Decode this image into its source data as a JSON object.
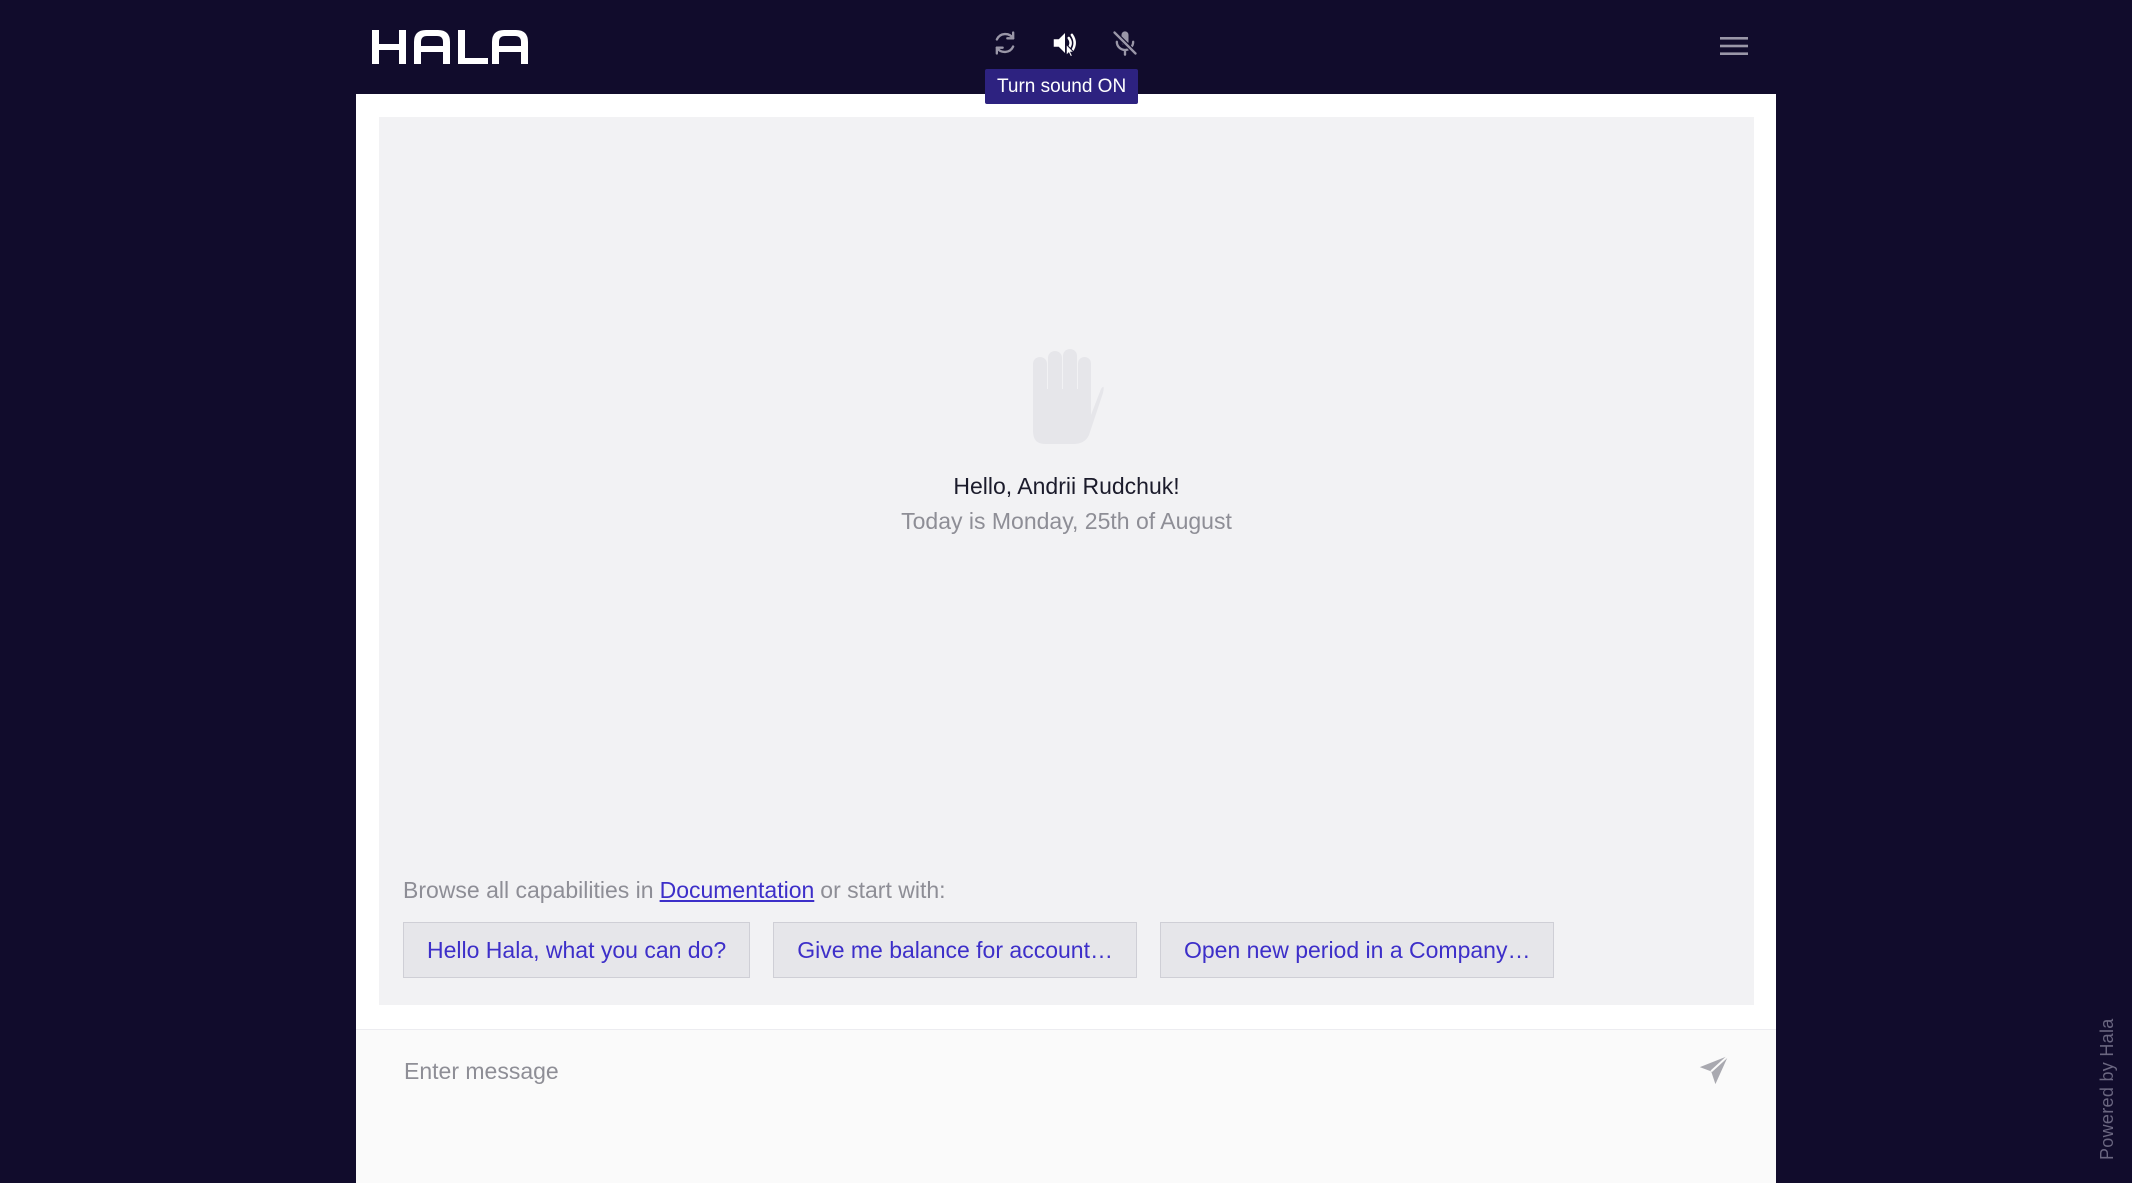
{
  "header": {
    "logo_text": "HALA",
    "icons": [
      "refresh-icon",
      "sound-off-icon",
      "mic-off-icon",
      "hamburger-menu-icon"
    ],
    "tooltip": "Turn sound ON"
  },
  "welcome": {
    "greeting": "Hello, Andrii Rudchuk!",
    "date": "Today is Monday, 25th of August"
  },
  "capabilities": {
    "prefix": "Browse all capabilities in",
    "link": "Documentation",
    "suffix": "or start with:"
  },
  "suggestions": [
    "Hello Hala, what you can do?",
    "Give me balance for account…",
    "Open new period in a Company…"
  ],
  "composer": {
    "placeholder": "Enter message"
  },
  "footer": {
    "powered_by": "Powered by Hala"
  },
  "colors": {
    "background": "#110c2c",
    "accent": "#3d2fc9",
    "tooltip_bg": "#2d2280"
  }
}
